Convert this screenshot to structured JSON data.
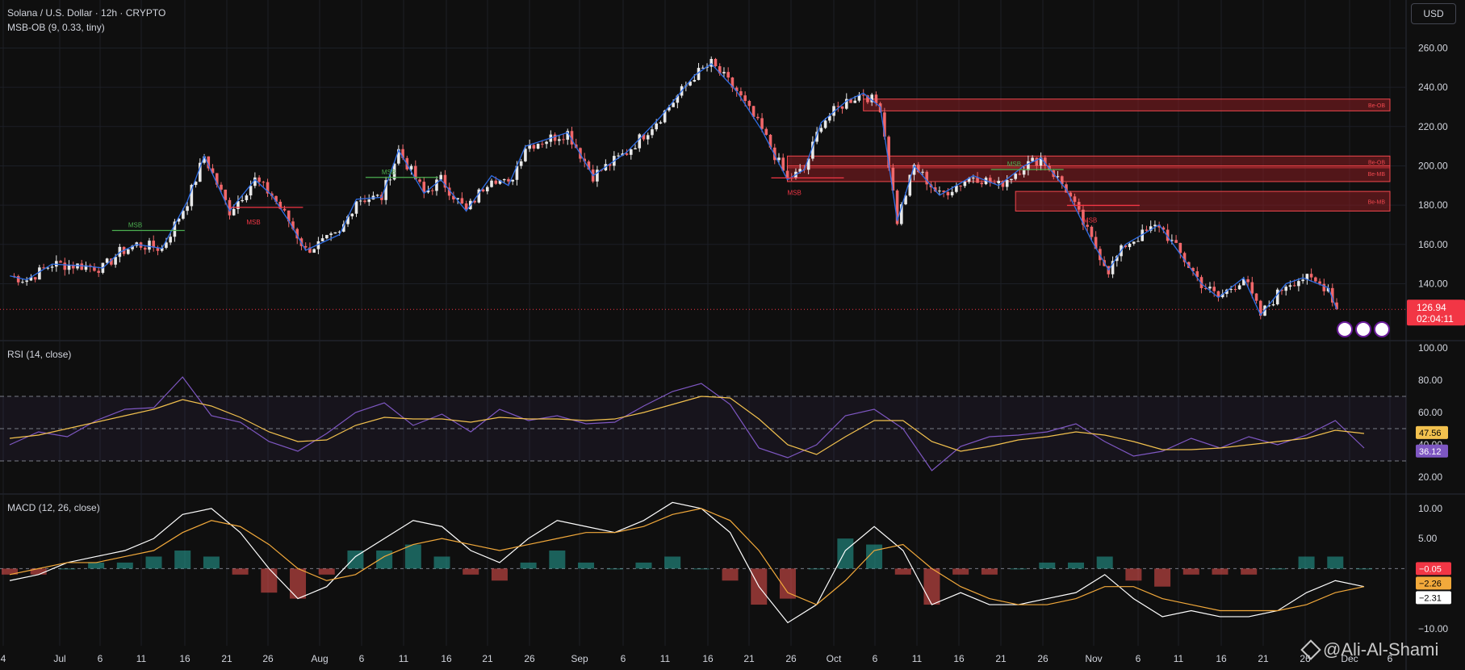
{
  "header": {
    "symbol_title": "Solana / U.S. Dollar · 12h · CRYPTO",
    "indicator": "MSB-OB (9, 0.33, tiny)",
    "currency_button": "USD"
  },
  "panes": {
    "rsi_title": "RSI (14, close)",
    "macd_title": "MACD (12, 26, close)"
  },
  "watermark": "@Ali-Al-Shami",
  "colors": {
    "background": "#0f0f0f",
    "up": "#e8e8e8",
    "down": "#f0676a",
    "zigzag": "#2f6ee6",
    "ob_fill": "#8a1d22",
    "ob_border": "#f2484e",
    "msb_green": "#4caf50",
    "msb_red": "#f23645",
    "rsi_line": "#7e57c2",
    "rsi_ma": "#f2c14e",
    "macd_line": "#ffffff",
    "signal_line": "#f2a93b",
    "hist_pos": "#b2dfdb",
    "hist_neg": "#ffcdd2"
  },
  "chart_data": [
    {
      "type": "candlestick",
      "name": "Solana / U.S. Dollar",
      "interval": "12h",
      "x_ticks": [
        "4",
        "Jul",
        "6",
        "11",
        "16",
        "21",
        "26",
        "Aug",
        "6",
        "11",
        "16",
        "21",
        "26",
        "Sep",
        "6",
        "11",
        "16",
        "21",
        "26",
        "Oct",
        "6",
        "11",
        "16",
        "21",
        "26",
        "Nov",
        "6",
        "11",
        "16",
        "21",
        "26",
        "Dec",
        "6"
      ],
      "y_ticks": [
        "260.00",
        "240.00",
        "220.00",
        "200.00",
        "180.00",
        "160.00",
        "140.00"
      ],
      "ylim": [
        118,
        268
      ],
      "last_price": "126.94",
      "countdown": "02:04:11",
      "close_path": [
        {
          "x": "Jun 29",
          "y": 144
        },
        {
          "x": "Jul 1",
          "y": 142
        },
        {
          "x": "Jul 4",
          "y": 150
        },
        {
          "x": "Jul 8",
          "y": 149
        },
        {
          "x": "Jul 10",
          "y": 148
        },
        {
          "x": "Jul 12",
          "y": 156
        },
        {
          "x": "Jul 14",
          "y": 160
        },
        {
          "x": "Jul 17",
          "y": 158
        },
        {
          "x": "Jul 20",
          "y": 182
        },
        {
          "x": "Jul 22",
          "y": 205
        },
        {
          "x": "Jul 25",
          "y": 177
        },
        {
          "x": "Jul 28",
          "y": 193
        },
        {
          "x": "Jul 30",
          "y": 185
        },
        {
          "x": "Aug 1",
          "y": 172
        },
        {
          "x": "Aug 3",
          "y": 157
        },
        {
          "x": "Aug 7",
          "y": 165
        },
        {
          "x": "Aug 9",
          "y": 183
        },
        {
          "x": "Aug 12",
          "y": 184
        },
        {
          "x": "Aug 14",
          "y": 208
        },
        {
          "x": "Aug 17",
          "y": 186
        },
        {
          "x": "Aug 19",
          "y": 193
        },
        {
          "x": "Aug 22",
          "y": 177
        },
        {
          "x": "Aug 25",
          "y": 195
        },
        {
          "x": "Aug 27",
          "y": 190
        },
        {
          "x": "Aug 29",
          "y": 210
        },
        {
          "x": "Sep 3",
          "y": 217
        },
        {
          "x": "Sep 6",
          "y": 195
        },
        {
          "x": "Sep 10",
          "y": 207
        },
        {
          "x": "Sep 14",
          "y": 225
        },
        {
          "x": "Sep 18",
          "y": 246
        },
        {
          "x": "Sep 20",
          "y": 252
        },
        {
          "x": "Sep 23",
          "y": 238
        },
        {
          "x": "Sep 26",
          "y": 218
        },
        {
          "x": "Sep 29",
          "y": 193
        },
        {
          "x": "Oct 1",
          "y": 198
        },
        {
          "x": "Oct 3",
          "y": 222
        },
        {
          "x": "Oct 6",
          "y": 233
        },
        {
          "x": "Oct 8",
          "y": 237
        },
        {
          "x": "Oct 10",
          "y": 230
        },
        {
          "x": "Oct 12",
          "y": 172
        },
        {
          "x": "Oct 14",
          "y": 200
        },
        {
          "x": "Oct 17",
          "y": 185
        },
        {
          "x": "Oct 21",
          "y": 195
        },
        {
          "x": "Oct 24",
          "y": 190
        },
        {
          "x": "Oct 27",
          "y": 200
        },
        {
          "x": "Oct 29",
          "y": 204
        },
        {
          "x": "Nov 1",
          "y": 188
        },
        {
          "x": "Nov 4",
          "y": 162
        },
        {
          "x": "Nov 6",
          "y": 147
        },
        {
          "x": "Nov 8",
          "y": 160
        },
        {
          "x": "Nov 12",
          "y": 170
        },
        {
          "x": "Nov 14",
          "y": 158
        },
        {
          "x": "Nov 17",
          "y": 140
        },
        {
          "x": "Nov 19",
          "y": 133
        },
        {
          "x": "Nov 22",
          "y": 143
        },
        {
          "x": "Nov 24",
          "y": 124
        },
        {
          "x": "Nov 27",
          "y": 140
        },
        {
          "x": "Nov 29",
          "y": 143
        },
        {
          "x": "Dec 2",
          "y": 138
        },
        {
          "x": "Dec 3",
          "y": 127
        }
      ],
      "structure_labels": [
        {
          "text": "MSB",
          "kind": "bullish",
          "price": 170
        },
        {
          "text": "MSB",
          "kind": "bearish",
          "price": 176
        },
        {
          "text": "MSB",
          "kind": "bullish",
          "price": 197
        },
        {
          "text": "MSB",
          "kind": "bearish",
          "price": 191
        },
        {
          "text": "MSB",
          "kind": "bullish",
          "price": 201
        },
        {
          "text": "MSB",
          "kind": "bearish",
          "price": 177
        }
      ],
      "order_blocks": [
        {
          "label": "Be-OB",
          "from": "Oct 8",
          "top": 234,
          "bottom": 228
        },
        {
          "label": "Be-OB",
          "from": "Sep 29",
          "top": 205,
          "bottom": 199
        },
        {
          "label": "Be-MB",
          "from": "Sep 29",
          "top": 200,
          "bottom": 192
        },
        {
          "label": "Be-MB",
          "from": "Oct 26",
          "top": 187,
          "bottom": 177
        }
      ]
    },
    {
      "type": "line",
      "name": "RSI (14, close)",
      "y_ticks": [
        "100.00",
        "80.00",
        "60.00",
        "40.00",
        "20.00"
      ],
      "ylim": [
        13,
        103
      ],
      "bands": [
        70,
        50,
        30
      ],
      "series": [
        {
          "name": "RSI",
          "last": "36.12",
          "values": [
            40,
            48,
            45,
            55,
            62,
            63,
            82,
            58,
            54,
            42,
            36,
            47,
            60,
            66,
            52,
            59,
            48,
            62,
            55,
            58,
            53,
            54,
            64,
            73,
            78,
            65,
            38,
            32,
            40,
            58,
            62,
            50,
            24,
            39,
            45,
            46,
            48,
            53,
            42,
            33,
            36,
            44,
            38,
            45,
            40,
            46,
            55,
            38
          ]
        },
        {
          "name": "RSI MA",
          "last": "47.56",
          "values": [
            44,
            46,
            50,
            54,
            58,
            62,
            68,
            64,
            57,
            48,
            42,
            43,
            52,
            57,
            56,
            56,
            54,
            57,
            56,
            56,
            55,
            56,
            60,
            65,
            70,
            69,
            56,
            40,
            34,
            45,
            55,
            55,
            42,
            36,
            39,
            43,
            45,
            48,
            46,
            42,
            37,
            37,
            38,
            40,
            42,
            44,
            49,
            47
          ]
        }
      ]
    },
    {
      "type": "bar",
      "name": "MACD (12, 26, close)",
      "y_ticks": [
        "10.00",
        "5.00",
        "−10.00"
      ],
      "ylim": [
        -11.5,
        12
      ],
      "series": [
        {
          "name": "MACD",
          "last": "−2.31",
          "values": [
            -2,
            -1,
            1,
            2,
            3,
            5,
            9,
            10,
            6,
            0,
            -5,
            -3,
            2,
            5,
            8,
            7,
            3,
            1,
            5,
            8,
            7,
            6,
            8,
            11,
            10,
            6,
            -3,
            -9,
            -6,
            3,
            7,
            3,
            -6,
            -4,
            -6,
            -6,
            -5,
            -4,
            -1,
            -5,
            -8,
            -7,
            -8,
            -8,
            -7,
            -4,
            -2,
            -3
          ]
        },
        {
          "name": "Signal",
          "last": "−2.26",
          "values": [
            -1,
            0,
            1,
            1,
            2,
            3,
            6,
            8,
            7,
            4,
            0,
            -2,
            -1,
            2,
            4,
            5,
            4,
            3,
            4,
            5,
            6,
            6,
            7,
            9,
            10,
            8,
            3,
            -4,
            -6,
            -2,
            3,
            4,
            0,
            -3,
            -5,
            -6,
            -6,
            -5,
            -3,
            -3,
            -5,
            -6,
            -7,
            -7,
            -7,
            -6,
            -4,
            -3
          ]
        },
        {
          "name": "Histogram",
          "last": "−0.05",
          "values": [
            -1,
            -1,
            0,
            1,
            1,
            2,
            3,
            2,
            -1,
            -4,
            -5,
            -1,
            3,
            3,
            4,
            2,
            -1,
            -2,
            1,
            3,
            1,
            0,
            1,
            2,
            0,
            -2,
            -6,
            -5,
            0,
            5,
            4,
            -1,
            -6,
            -1,
            -1,
            0,
            1,
            1,
            2,
            -2,
            -3,
            -1,
            -1,
            -1,
            0,
            2,
            2,
            0
          ]
        }
      ]
    }
  ]
}
